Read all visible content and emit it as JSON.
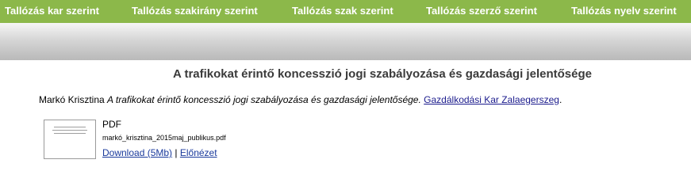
{
  "nav": {
    "items": [
      {
        "label": "Tallózás kar szerint"
      },
      {
        "label": "Tallózás szakirány szerint"
      },
      {
        "label": "Tallózás szak szerint"
      },
      {
        "label": "Tallózás szerző szerint"
      },
      {
        "label": "Tallózás nyelv szerint"
      }
    ]
  },
  "record": {
    "title": "A trafikokat érintő koncesszió jogi szabályozása és gazdasági jelentősége",
    "author": "Markó Krisztina",
    "title_italic": "A trafikokat érintő koncesszió jogi szabályozása és gazdasági jelentősége.",
    "faculty_link": "Gazdálkodási Kar Zalaegerszeg",
    "faculty_suffix": "."
  },
  "document": {
    "type": "PDF",
    "filename": "markó_krisztina_2015maj_publikus.pdf",
    "download_label": "Download (5Mb)",
    "separator": "|",
    "preview_label": "Előnézet"
  },
  "colors": {
    "nav_bg": "#8cb84a",
    "link": "#1a1a8c"
  }
}
